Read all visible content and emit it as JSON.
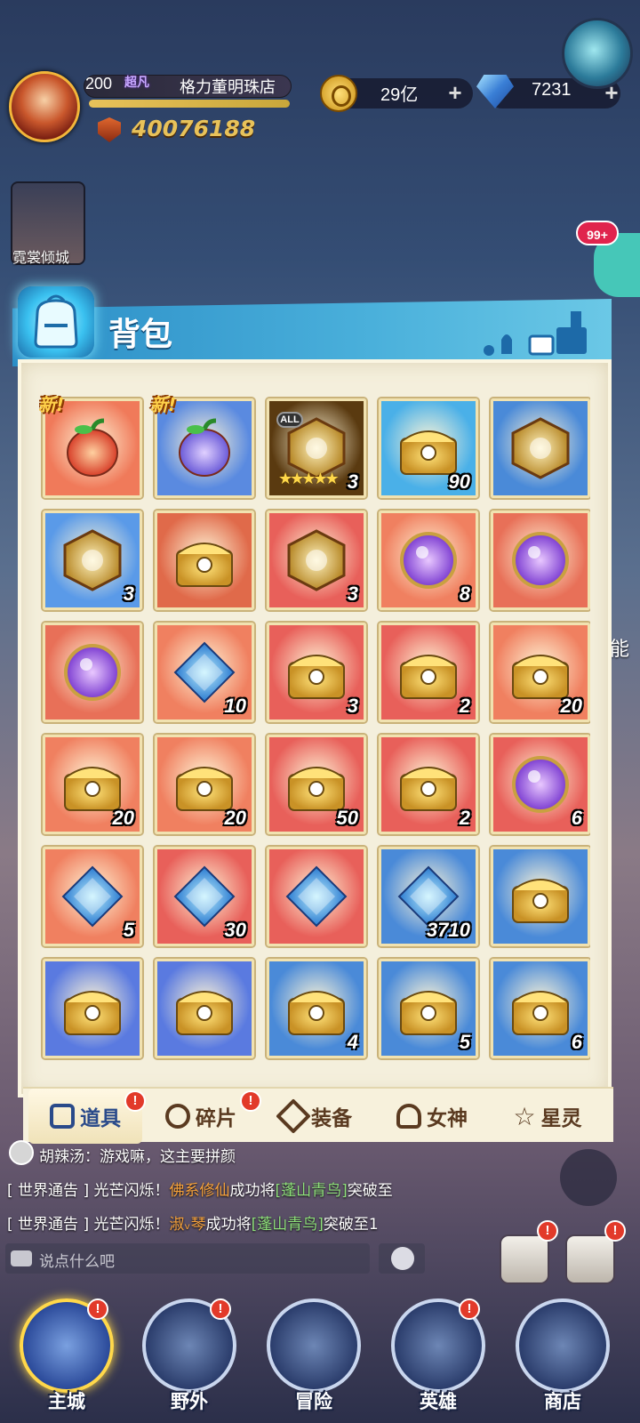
{
  "player": {
    "level": "200",
    "rank": "超凡",
    "guild_name": "格力董明珠店",
    "power": "40076188",
    "xp_percent": 100
  },
  "resources": {
    "coins": "29亿",
    "gems": "7231",
    "plus": "+"
  },
  "hero_card": {
    "name": "霓裳倾城"
  },
  "notification_badge": "99+",
  "panel": {
    "title": "背包"
  },
  "items": [
    {
      "tag": "新!",
      "count": "",
      "icon": "red-pepper-fruit",
      "bg": "#f07a5a"
    },
    {
      "tag": "新!",
      "count": "",
      "icon": "purple-pepper-fruit",
      "bg": "#5a8ae0"
    },
    {
      "all": "ALL",
      "stars": "★★★★★",
      "count": "3",
      "icon": "golden-dragon-mask",
      "bg": "#5a3a10"
    },
    {
      "count": "90",
      "icon": "blue-gold-chest",
      "bg": "#4ab0e8"
    },
    {
      "count": "",
      "icon": "rune-book",
      "bg": "#4a8ad8"
    },
    {
      "count": "3",
      "icon": "flame-orb-emblem",
      "bg": "#5a9ae8"
    },
    {
      "count": "",
      "icon": "portrait-chest",
      "bg": "#e06a4a"
    },
    {
      "count": "3",
      "icon": "red-hexagon-emblem",
      "bg": "#e8605a"
    },
    {
      "count": "8",
      "icon": "swirl-sphere-statue",
      "bg": "#f08060"
    },
    {
      "count": "",
      "icon": "purple-crystal-orb",
      "bg": "#e87058"
    },
    {
      "count": "",
      "icon": "purple-crystal-orb",
      "bg": "#e87058"
    },
    {
      "count": "10",
      "icon": "star-shard",
      "bg": "#f08060"
    },
    {
      "count": "3",
      "icon": "silver-red-chest",
      "bg": "#e8605a"
    },
    {
      "count": "2",
      "icon": "silver-red-chest",
      "bg": "#e8605a"
    },
    {
      "count": "20",
      "icon": "cat-gold-chest",
      "bg": "#f08060"
    },
    {
      "count": "20",
      "icon": "white-gold-chest",
      "bg": "#f08060"
    },
    {
      "count": "20",
      "icon": "white-gold-chest",
      "bg": "#f08060"
    },
    {
      "count": "50",
      "icon": "white-red-cube",
      "bg": "#e8605a"
    },
    {
      "count": "2",
      "icon": "red-gold-chest",
      "bg": "#e8605a"
    },
    {
      "count": "6",
      "icon": "rainbow-crystal-ball",
      "bg": "#e8605a"
    },
    {
      "count": "5",
      "icon": "dark-crystal-rock",
      "bg": "#f08060"
    },
    {
      "count": "30",
      "icon": "blue-diamond",
      "bg": "#e8605a"
    },
    {
      "count": "",
      "icon": "purple-star",
      "bg": "#e8605a"
    },
    {
      "count": "3710",
      "icon": "blue-gem-frame",
      "bg": "#4a8ad8"
    },
    {
      "count": "",
      "icon": "purple-gold-chest",
      "bg": "#4a8ad8"
    },
    {
      "count": "",
      "icon": "purple-gem-box",
      "bg": "#5a7ae0"
    },
    {
      "count": "",
      "icon": "purple-gem-box",
      "bg": "#5a7ae0"
    },
    {
      "count": "4",
      "icon": "gold-blue-chest",
      "bg": "#4a8ad8"
    },
    {
      "count": "5",
      "icon": "gold-blue-chest",
      "bg": "#4a8ad8"
    },
    {
      "count": "6",
      "icon": "silver-blue-chest",
      "bg": "#4a8ad8"
    }
  ],
  "tabs": [
    {
      "label": "道具",
      "alert": "!"
    },
    {
      "label": "碎片",
      "alert": "!"
    },
    {
      "label": "装备"
    },
    {
      "label": "女神"
    },
    {
      "label": "星灵"
    }
  ],
  "chat": {
    "line1": "胡辣汤：游戏嘛，这主要拼颜",
    "line2_prefix": "[ 世界通告 ] 光芒闪烁！",
    "line2_name": "佛系修仙",
    "line2_mid": "成功将",
    "line2_target": "[蓬山青鸟]",
    "line2_suffix": "突破至",
    "line3_prefix": "[ 世界通告 ] 光芒闪烁！",
    "line3_name": "淑ᵥ琴",
    "line3_mid": "成功将",
    "line3_target": "[蓬山青鸟]",
    "line3_suffix": "突破至1",
    "placeholder": "说点什么吧"
  },
  "side_label": "能",
  "nav": [
    {
      "label": "主城",
      "alert": "!"
    },
    {
      "label": "野外",
      "alert": "!"
    },
    {
      "label": "冒险"
    },
    {
      "label": "英雄",
      "alert": "!"
    },
    {
      "label": "商店"
    }
  ],
  "colors": {
    "panel_header": "#3aa6d6",
    "panel_body": "#f4efdc",
    "count_text": "#ffffff",
    "new_tag": "#ffd24a",
    "alert": "#e23a2a"
  }
}
